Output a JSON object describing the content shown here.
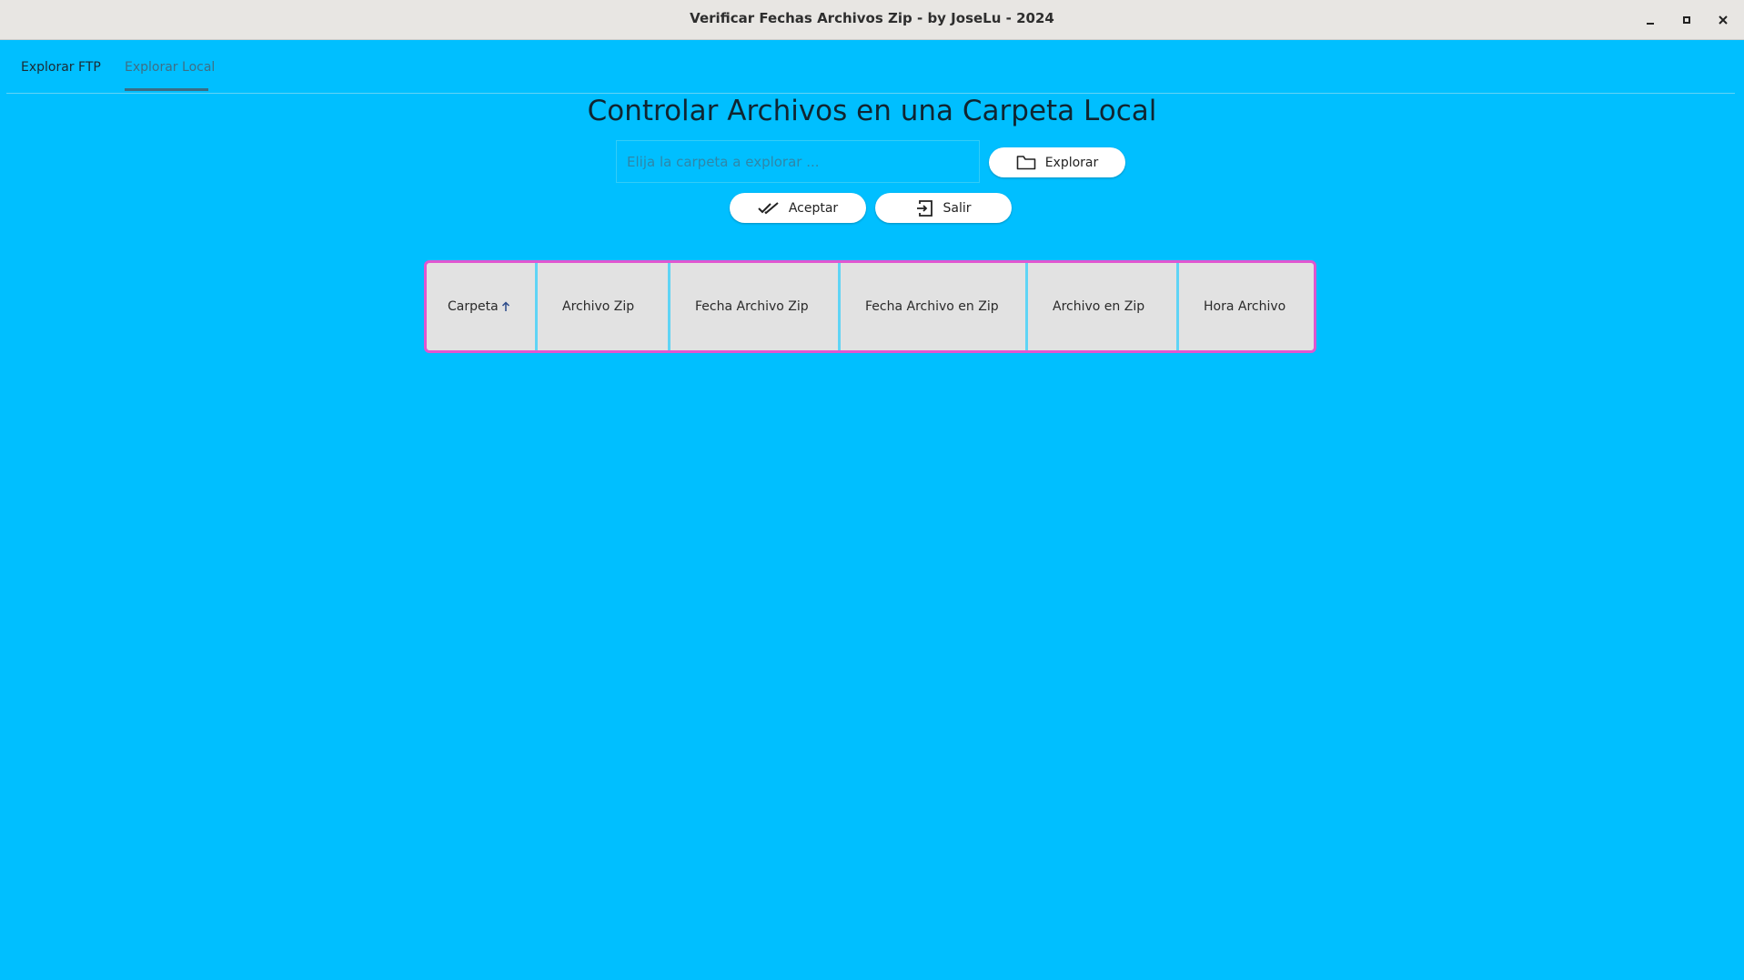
{
  "window": {
    "title": "Verificar Fechas Archivos Zip - by JoseLu - 2024",
    "controls": [
      "minimize-icon",
      "maximize-icon",
      "close-icon"
    ]
  },
  "tabs": [
    {
      "label": "Explorar FTP",
      "selected": false
    },
    {
      "label": "Explorar Local",
      "selected": true
    }
  ],
  "main": {
    "title": "Controlar Archivos en una Carpeta Local",
    "folder_input": {
      "placeholder": "Elija la carpeta a explorar ...",
      "value": ""
    },
    "explore_button": {
      "label": "Explorar",
      "icon": "folder-icon"
    },
    "accept_button": {
      "label": "Aceptar",
      "icon": "double-check-icon"
    },
    "exit_button": {
      "label": "Salir",
      "icon": "exit-icon"
    }
  },
  "table": {
    "columns": [
      {
        "label": "Carpeta",
        "sort": "ascending",
        "sort_icon": "arrow-up-icon"
      },
      {
        "label": "Archivo Zip"
      },
      {
        "label": "Fecha Archivo Zip"
      },
      {
        "label": "Fecha Archivo en Zip"
      },
      {
        "label": "Archivo en Zip"
      },
      {
        "label": "Hora Archivo"
      }
    ],
    "rows": []
  },
  "colors": {
    "background": "#00bfff",
    "table_border": "#e056d0",
    "column_divider": "#5fd4f5",
    "header_bg": "#e2e2e2",
    "titlebar": "#e8e6e3"
  }
}
